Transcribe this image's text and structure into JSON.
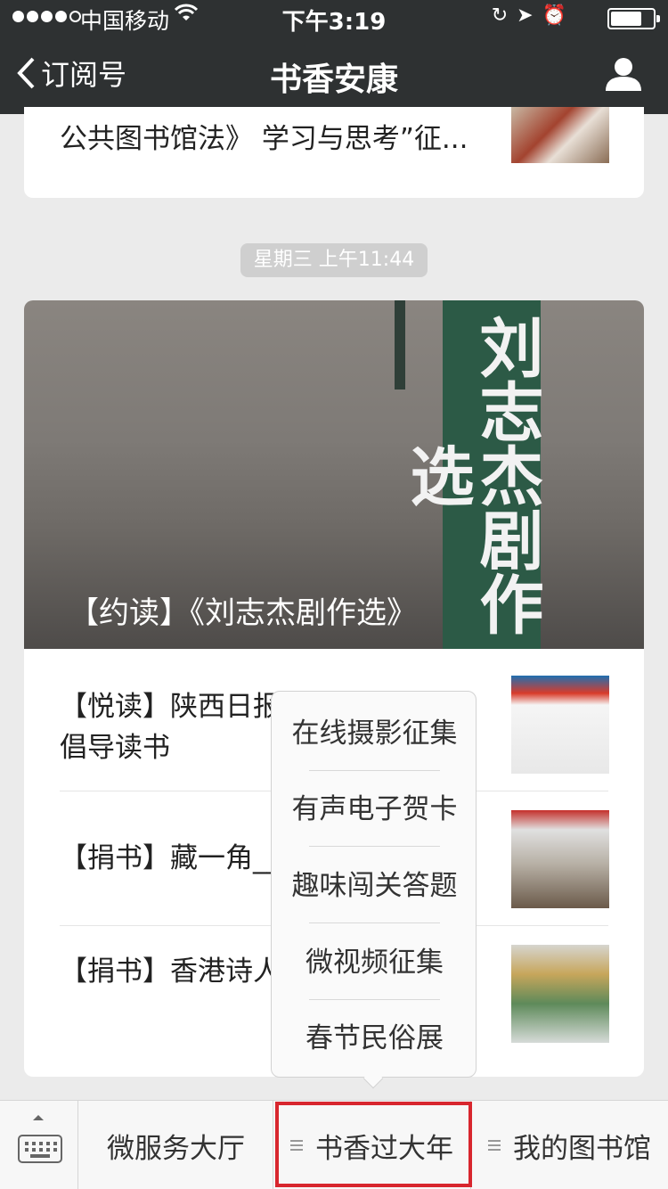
{
  "status_bar": {
    "carrier": "中国移动",
    "time": "下午3:19"
  },
  "nav": {
    "back_label": "订阅号",
    "title": "书香安康"
  },
  "previous_card": {
    "title": "公共图书馆法》 学习与思考”征..."
  },
  "timestamp": "星期三 上午11:44",
  "article": {
    "hero_caption": "【约读】《刘志杰剧作选》",
    "hero_banner_text": "刘志杰剧作选",
    "rows": [
      {
        "title": "【悦读】陕西日报______公益演讲倡导读书"
      },
      {
        "title": "【捐书】藏一角___"
      },
      {
        "title": "【捐书】香港诗人___书"
      }
    ]
  },
  "popup_menu": {
    "items": [
      "在线摄影征集",
      "有声电子贺卡",
      "趣味闯关答题",
      "微视频征集",
      "春节民俗展"
    ]
  },
  "bottom_menu": {
    "items": [
      "微服务大厅",
      "书香过大年",
      "我的图书馆"
    ]
  },
  "colors": {
    "nav_bg": "#2e3132",
    "highlight_border": "#d8262e",
    "banner_green": "#2c5a46"
  }
}
